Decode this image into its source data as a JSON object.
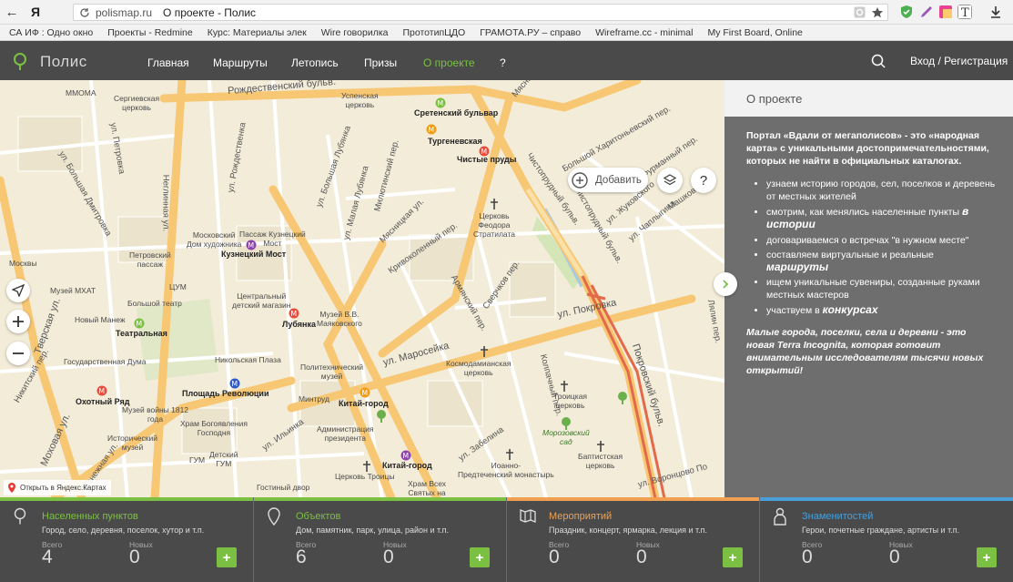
{
  "browser": {
    "host": "polismap.ru",
    "page_title": "О проекте - Полис",
    "back_icon": "back-arrow-icon",
    "yandex_glyph": "Я",
    "bookmarks": [
      "СА ИФ : Одно окно",
      "Проекты - Redmine",
      "Курс: Материалы элек",
      "Wire говорилка",
      "ПрототипЦДО",
      "ГРАМОТА.РУ – справо",
      "Wireframe.cc - minimal",
      "My First Board, Online"
    ]
  },
  "header": {
    "logo": "Полис",
    "menu": [
      {
        "label": "Главная",
        "active": false
      },
      {
        "label": "Маршруты",
        "active": false
      },
      {
        "label": "Летопись",
        "active": false
      },
      {
        "label": "Призы",
        "active": false
      },
      {
        "label": "О проекте",
        "active": true
      },
      {
        "label": "?",
        "active": false
      }
    ],
    "login": "Вход / Регистрация"
  },
  "map": {
    "add_label": "Добавить",
    "help_label": "?",
    "yandex_link": "Открыть в Яндекс.Картах",
    "labels": {
      "mmoma": "ММОМА",
      "sergievskaya": "Сергиевская\nцерковь",
      "rozhdestvensky": "Рождественский бульв.",
      "uspenskaya": "Успенская\nцерковь",
      "sretensky": "Сретенский бульвар",
      "turgenevskaya": "Тургеневская",
      "chistye": "Чистые пруды",
      "myasnitskaya_top": "Мясни",
      "kharitonyevsky": "Большой Харитоньевский пер.",
      "furmanny": "Фурманный пер.",
      "mashkova": "Машкова ул.",
      "chaplygina": "ул. Чаплыгина",
      "zhukovskogo": "ул. Жуковского",
      "petrovka": "ул. Петровка",
      "rozhdestvenka": "ул. Рождественка",
      "b_lubyanka": "ул. Большая Лубянка",
      "neglinnaya": "Неглинная ул.",
      "dmitrovka": "ул. Большая Дмитровка",
      "m_lubyanka": "ул. Малая Лубянка",
      "milyutinsky": "Милютинский пер.",
      "myasnitskaya": "Мясницкая ул.",
      "chistoprudny": "Чистопрудный бульв.",
      "fyodor": "Церковь\nФеодора\nСтратилата",
      "petrovsky_passage": "Петровский\nпассаж",
      "house_artist": "Московский\nДом художника",
      "kuzn_passage": "Пассаж Кузнецкий\nМост",
      "kuznetsky": "Кузнецкий Мост",
      "krivokolenny": "Кривоколенный пер.",
      "sverchkov": "Сверчков пер.",
      "moscow": "Москвы",
      "mxat": "Музей МХАТ",
      "tsum": "ЦУМ",
      "bolshoi": "Большой театр",
      "novy_manezh": "Новый Манеж",
      "detsky": "Центральный\nдетский магазин",
      "lubyanka": "Лубянка",
      "mayakovsky": "Музей В.В.\nМаяковского",
      "armyansky": "Армянский пер.",
      "pokrovka": "ул. Покровка",
      "tverskaya": "Тверская ул.",
      "teatralnaya": "Театральная",
      "duma": "Государственная Дума",
      "nikolskaya": "Никольская Плаза",
      "polytech": "Политехнический\nмузей",
      "maroseyka": "ул. Маросейка",
      "kosmodamian": "Космодамианская\nцерковь",
      "pokrovsky": "Покровский бульв.",
      "nikitsky": "Никитский пер.",
      "okhotny": "Охотный Ряд",
      "ploshchad": "Площадь Революции",
      "mintrud": "Минтруд",
      "kitay": "Китай-город",
      "kolpachny": "Колпачный пер.",
      "troitskaya": "Троицкая\nцерковь",
      "war_museum": "Музей войны 1812\nгода",
      "bogoyavlen": "Храм Богоявления\nГосподня",
      "admin": "Администрация\nпрезидента",
      "morozov": "Морозовский\nсад",
      "mokhovaya": "Моховая ул.",
      "istorich": "Исторический\nмузей",
      "ilyinka": "ул. Ильинка",
      "zabelina": "ул. Забелина",
      "baptist": "Баптистская\nцерковь",
      "detsky_gum": "Детский\nГУМ",
      "gum": "ГУМ",
      "kitay2": "Китай-город",
      "ioanno": "Иоанно-\nПредтеченский монастырь",
      "manezhnaya": "Манежная ул.",
      "troitsa": "Церковь Троицы",
      "gostiny": "Гостиный двор",
      "vsekh": "Храм Всех\nСвятых на",
      "vorontsovo": "ул. Воронцово По",
      "lyalin": "Лялин пер."
    }
  },
  "about": {
    "header": "О проекте",
    "intro": "Портал «Вдали от мегаполисов» - это «народная карта» с уникальными достопримечательностями, которых не найти в официальных каталогах.",
    "items": [
      {
        "text": "узнаем историю городов, сел, поселков и деревень от местных жителей",
        "em": ""
      },
      {
        "text": "смотрим, как менялись населенные пункты ",
        "em": "в истории"
      },
      {
        "text": "договариваемся о встречах \"в нужном месте\"",
        "em": ""
      },
      {
        "text": "составляем виртуальные и реальные ",
        "em": "маршруты"
      },
      {
        "text": "ищем уникальные сувениры, созданные руками местных мастеров",
        "em": ""
      },
      {
        "text": "участвуем в ",
        "em": "конкурсах"
      }
    ],
    "outro": "Малые города, поселки, села и деревни - это новая Terra Incognita, которая готовит внимательным исследователям тысячи новых открытий!"
  },
  "stats": [
    {
      "title": "Населенных пунктов",
      "desc": "Город, село, деревня, поселок, хутор и т.п.",
      "total_label": "Всего",
      "total": "4",
      "new_label": "Новых",
      "new": "0",
      "color": "#7bc043",
      "icon": "location-pin-icon"
    },
    {
      "title": "Объектов",
      "desc": "Дом, памятник, парк, улица, район и т.п.",
      "total_label": "Всего",
      "total": "6",
      "new_label": "Новых",
      "new": "0",
      "color": "#7bc043",
      "icon": "map-marker-icon"
    },
    {
      "title": "Мероприятий",
      "desc": "Праздник, концерт, ярмарка, лекция и т.п.",
      "total_label": "Всего",
      "total": "0",
      "new_label": "Новых",
      "new": "0",
      "color": "#f0a050",
      "icon": "map-fold-icon"
    },
    {
      "title": "Знаменитостей",
      "desc": "Герои, почетные граждане, артисты и т.п.",
      "total_label": "Всего",
      "total": "0",
      "new_label": "Новых",
      "new": "0",
      "color": "#4a9fd8",
      "icon": "person-icon"
    }
  ],
  "colors": {
    "accent": "#7bc043",
    "header_bg": "#4a4a4a",
    "panel_bg": "#6e6e6e"
  }
}
